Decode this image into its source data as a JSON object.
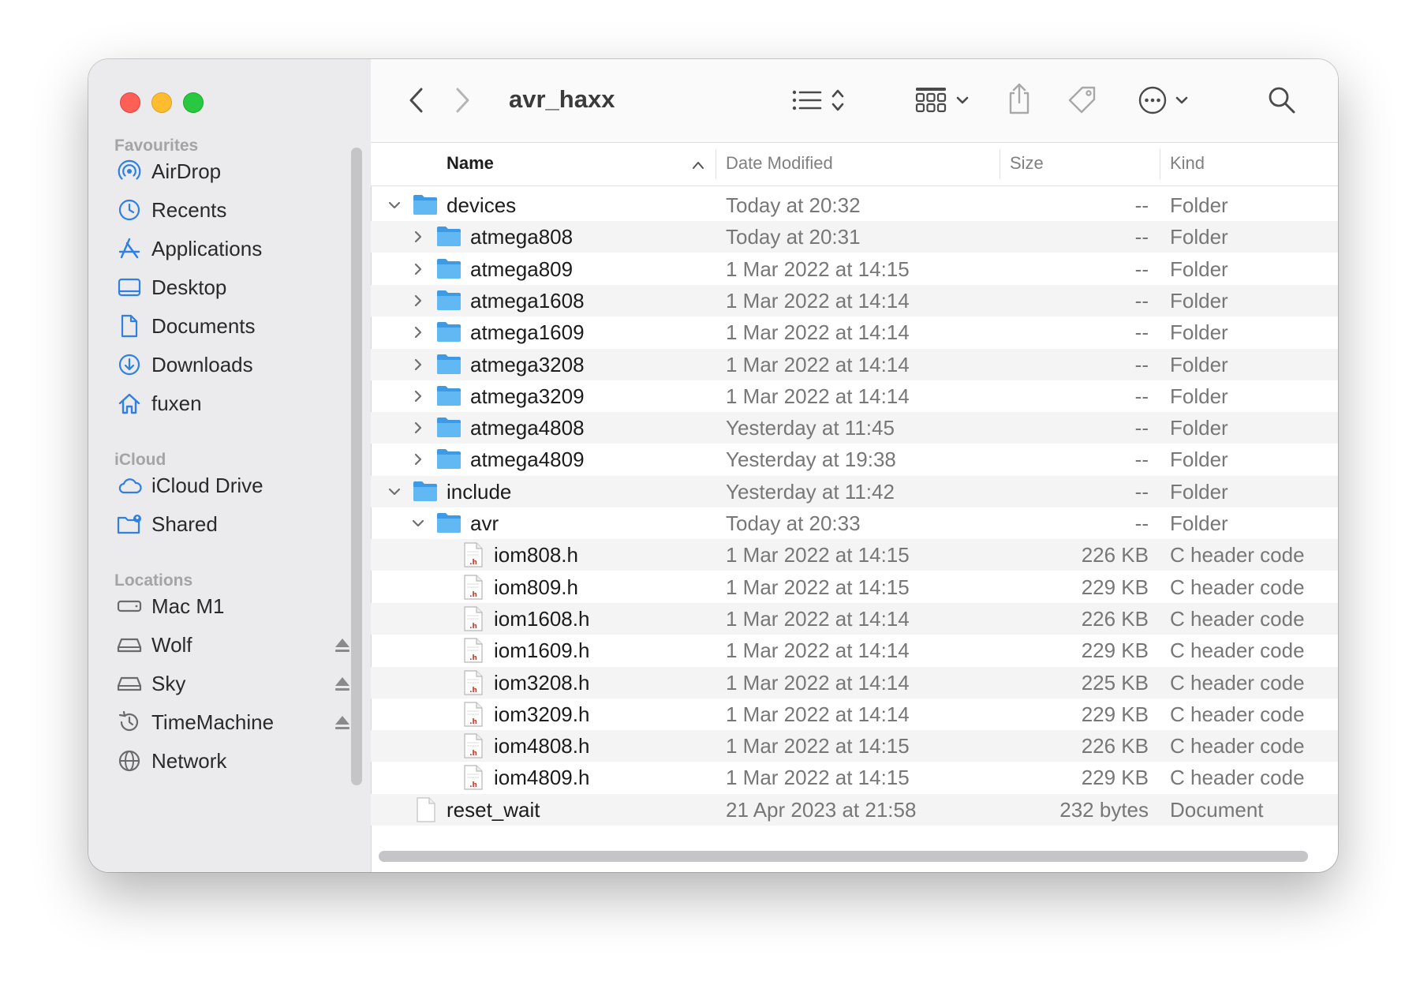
{
  "toolbar": {
    "title": "avr_haxx"
  },
  "sidebar": {
    "sections": [
      {
        "heading": "Favourites",
        "items": [
          {
            "label": "AirDrop",
            "icon": "airdrop-icon"
          },
          {
            "label": "Recents",
            "icon": "clock-icon"
          },
          {
            "label": "Applications",
            "icon": "applications-icon"
          },
          {
            "label": "Desktop",
            "icon": "desktop-icon"
          },
          {
            "label": "Documents",
            "icon": "document-icon"
          },
          {
            "label": "Downloads",
            "icon": "download-icon"
          },
          {
            "label": "fuxen",
            "icon": "home-icon"
          }
        ]
      },
      {
        "heading": "iCloud",
        "items": [
          {
            "label": "iCloud Drive",
            "icon": "cloud-icon"
          },
          {
            "label": "Shared",
            "icon": "shared-folder-icon"
          }
        ]
      },
      {
        "heading": "Locations",
        "items": [
          {
            "label": "Mac M1",
            "icon": "internal-disk-icon"
          },
          {
            "label": "Wolf",
            "icon": "external-disk-icon",
            "eject": true
          },
          {
            "label": "Sky",
            "icon": "external-disk-icon",
            "eject": true
          },
          {
            "label": "TimeMachine",
            "icon": "time-machine-icon",
            "eject": true
          },
          {
            "label": "Network",
            "icon": "network-icon"
          }
        ]
      }
    ]
  },
  "columns": {
    "name": "Name",
    "date": "Date Modified",
    "size": "Size",
    "kind": "Kind"
  },
  "files": [
    {
      "name": "devices",
      "date": "Today at 20:32",
      "size": "--",
      "kind": "Folder",
      "level": 0,
      "type": "folder",
      "disclosure": "open"
    },
    {
      "name": "atmega808",
      "date": "Today at 20:31",
      "size": "--",
      "kind": "Folder",
      "level": 1,
      "type": "folder",
      "disclosure": "closed"
    },
    {
      "name": "atmega809",
      "date": "1 Mar 2022 at 14:15",
      "size": "--",
      "kind": "Folder",
      "level": 1,
      "type": "folder",
      "disclosure": "closed"
    },
    {
      "name": "atmega1608",
      "date": "1 Mar 2022 at 14:14",
      "size": "--",
      "kind": "Folder",
      "level": 1,
      "type": "folder",
      "disclosure": "closed"
    },
    {
      "name": "atmega1609",
      "date": "1 Mar 2022 at 14:14",
      "size": "--",
      "kind": "Folder",
      "level": 1,
      "type": "folder",
      "disclosure": "closed"
    },
    {
      "name": "atmega3208",
      "date": "1 Mar 2022 at 14:14",
      "size": "--",
      "kind": "Folder",
      "level": 1,
      "type": "folder",
      "disclosure": "closed"
    },
    {
      "name": "atmega3209",
      "date": "1 Mar 2022 at 14:14",
      "size": "--",
      "kind": "Folder",
      "level": 1,
      "type": "folder",
      "disclosure": "closed"
    },
    {
      "name": "atmega4808",
      "date": "Yesterday at 11:45",
      "size": "--",
      "kind": "Folder",
      "level": 1,
      "type": "folder",
      "disclosure": "closed"
    },
    {
      "name": "atmega4809",
      "date": "Yesterday at 19:38",
      "size": "--",
      "kind": "Folder",
      "level": 1,
      "type": "folder",
      "disclosure": "closed"
    },
    {
      "name": "include",
      "date": "Yesterday at 11:42",
      "size": "--",
      "kind": "Folder",
      "level": 0,
      "type": "folder",
      "disclosure": "open"
    },
    {
      "name": "avr",
      "date": "Today at 20:33",
      "size": "--",
      "kind": "Folder",
      "level": 1,
      "type": "folder",
      "disclosure": "open"
    },
    {
      "name": "iom808.h",
      "date": "1 Mar 2022 at 14:15",
      "size": "226 KB",
      "kind": "C header code",
      "level": 2,
      "type": "header",
      "disclosure": "none"
    },
    {
      "name": "iom809.h",
      "date": "1 Mar 2022 at 14:15",
      "size": "229 KB",
      "kind": "C header code",
      "level": 2,
      "type": "header",
      "disclosure": "none"
    },
    {
      "name": "iom1608.h",
      "date": "1 Mar 2022 at 14:14",
      "size": "226 KB",
      "kind": "C header code",
      "level": 2,
      "type": "header",
      "disclosure": "none"
    },
    {
      "name": "iom1609.h",
      "date": "1 Mar 2022 at 14:14",
      "size": "229 KB",
      "kind": "C header code",
      "level": 2,
      "type": "header",
      "disclosure": "none"
    },
    {
      "name": "iom3208.h",
      "date": "1 Mar 2022 at 14:14",
      "size": "225 KB",
      "kind": "C header code",
      "level": 2,
      "type": "header",
      "disclosure": "none"
    },
    {
      "name": "iom3209.h",
      "date": "1 Mar 2022 at 14:14",
      "size": "229 KB",
      "kind": "C header code",
      "level": 2,
      "type": "header",
      "disclosure": "none"
    },
    {
      "name": "iom4808.h",
      "date": "1 Mar 2022 at 14:15",
      "size": "226 KB",
      "kind": "C header code",
      "level": 2,
      "type": "header",
      "disclosure": "none"
    },
    {
      "name": "iom4809.h",
      "date": "1 Mar 2022 at 14:15",
      "size": "229 KB",
      "kind": "C header code",
      "level": 2,
      "type": "header",
      "disclosure": "none"
    },
    {
      "name": "reset_wait",
      "date": "21 Apr 2023 at 21:58",
      "size": "232 bytes",
      "kind": "Document",
      "level": 0,
      "type": "document",
      "disclosure": "none"
    }
  ],
  "icon_header_label": ".h",
  "colors": {
    "accent": "#1f7ae0",
    "folder": "#5ab2ee",
    "row_alt": "#f4f4f5"
  }
}
